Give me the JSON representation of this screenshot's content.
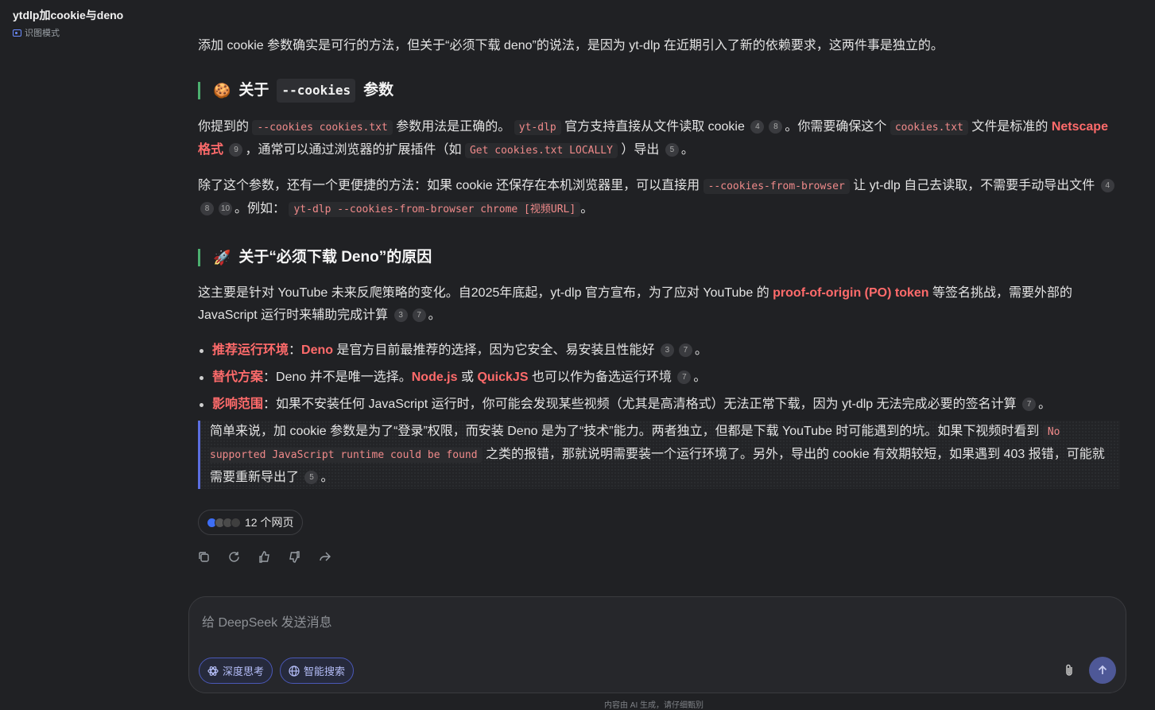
{
  "header": {
    "title": "ytdlp加cookie与deno",
    "mode_label": "识图模式"
  },
  "intro": "添加 cookie 参数确实是可行的方法，但关于“必须下载 deno”的说法，是因为 yt-dlp 在近期引入了新的依赖要求，这两件事是独立的。",
  "section1": {
    "emoji": "🍪",
    "title_a": "关于",
    "title_code": "--cookies",
    "title_b": "参数",
    "p1": {
      "t1": "你提到的",
      "c1": "--cookies cookies.txt",
      "t2": "参数用法是正确的。",
      "c2": "yt-dlp",
      "t3": "官方支持直接从文件读取 cookie",
      "cites1": [
        "4",
        "8"
      ],
      "t4": "。你需要确保这个",
      "c3": "cookies.txt",
      "t5": "文件是标准的",
      "hl": "Netscape 格式",
      "cite2": "9",
      "t6": "，通常可以通过浏览器的扩展插件（如",
      "c4": "Get cookies.txt LOCALLY",
      "t7": "）导出",
      "cite3": "5",
      "t8": "。"
    },
    "p2": {
      "t1": "除了这个参数，还有一个更便捷的方法：如果 cookie 还保存在本机浏览器里，可以直接用",
      "c1": "--cookies-from-browser",
      "t2": "让 yt-dlp 自己去读取，不需要手动导出文件",
      "cites": [
        "4",
        "8",
        "10"
      ],
      "t3": "。例如：",
      "c2": "yt-dlp --cookies-from-browser chrome [视频URL]",
      "t4": "。"
    }
  },
  "section2": {
    "emoji": "🚀",
    "title": "关于“必须下载 Deno”的原因",
    "p1": {
      "t1": "这主要是针对 YouTube 未来反爬策略的变化。自2025年底起，yt-dlp 官方宣布，为了应对 YouTube 的",
      "hl": "proof-of-origin (PO) token",
      "t2": "等签名挑战，需要外部的 JavaScript 运行时来辅助完成计算",
      "cites": [
        "3",
        "7"
      ],
      "t3": "。"
    },
    "bullets": [
      {
        "label": "推荐运行环境",
        "sep": "：",
        "hl": "Deno",
        "text": "是官方目前最推荐的选择，因为它安全、易安装且性能好",
        "cites": [
          "3",
          "7"
        ],
        "end": "。"
      },
      {
        "label": "替代方案",
        "sep": "：",
        "t1": "Deno 并不是唯一选择。",
        "hl1": "Node.js",
        "t2": "或",
        "hl2": "QuickJS",
        "t3": "也可以作为备选运行环境",
        "cites": [
          "7"
        ],
        "end": "。"
      },
      {
        "label": "影响范围",
        "sep": "：",
        "text": "如果不安装任何 JavaScript 运行时，你可能会发现某些视频（尤其是高清格式）无法正常下载，因为 yt-dlp 无法完成必要的签名计算",
        "cites": [
          "7"
        ],
        "end": "。"
      }
    ]
  },
  "quote": {
    "t1": "简单来说，加 cookie 参数是为了“登录”权限，而安装 Deno 是为了“技术”能力。两者独立，但都是下载 YouTube 时可能遇到的坑。如果下视频时看到",
    "c1": "No supported JavaScript runtime could be found",
    "t2": "之类的报错，那就说明需要装一个运行环境了。另外，导出的 cookie 有效期较短，如果遇到 403 报错，可能就需要重新导出了",
    "cite": "5",
    "t3": "。"
  },
  "sources": {
    "label": "12 个网页"
  },
  "composer": {
    "placeholder": "给 DeepSeek 发送消息",
    "deep_think": "深度思考",
    "web_search": "智能搜索"
  },
  "footer": "内容由 AI 生成，请仔细甄别",
  "colors": {
    "accent": "#4e5897",
    "highlight": "#ff6b6b",
    "heading_bar": "#4caf6f",
    "quote_bar": "#5b6ee0"
  }
}
